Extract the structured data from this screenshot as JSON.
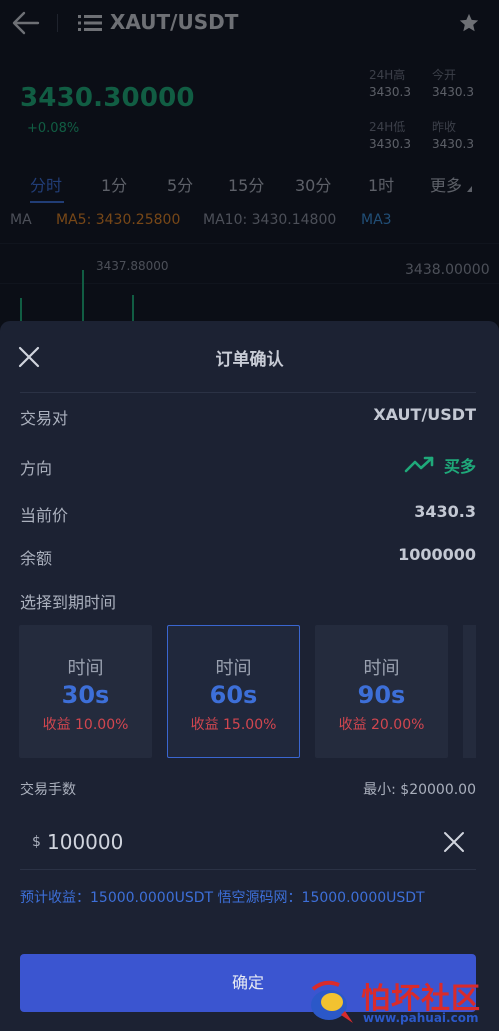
{
  "header": {
    "pair": "XAUT/USDT"
  },
  "ticker": {
    "price": "3430.30000",
    "change": "+0.08%",
    "stats": [
      {
        "label": "24H高",
        "value": "3430.3"
      },
      {
        "label": "今开",
        "value": "3430.3"
      },
      {
        "label": "24H低",
        "value": "3430.3"
      },
      {
        "label": "昨收",
        "value": "3430.3"
      }
    ]
  },
  "periods": [
    "分时",
    "1分",
    "5分",
    "15分",
    "30分",
    "1时",
    "更多"
  ],
  "active_period": "分时",
  "indicators": {
    "ma": "MA",
    "ma5": "MA5: 3430.25800",
    "ma10": "MA10: 3430.14800",
    "ma30": "MA3"
  },
  "chart": {
    "high_label": "3437.88000",
    "axis_label": "3438.00000"
  },
  "sheet": {
    "title": "订单确认",
    "rows": [
      {
        "label": "交易对",
        "value": "XAUT/USDT"
      },
      {
        "label": "方向",
        "value": "买多"
      },
      {
        "label": "当前价",
        "value": "3430.3"
      },
      {
        "label": "余额",
        "value": "1000000"
      }
    ],
    "expiry_title": "选择到期时间",
    "options": [
      {
        "label": "时间",
        "duration": "30s",
        "profit": "收益 10.00%",
        "selected": false
      },
      {
        "label": "时间",
        "duration": "60s",
        "profit": "收益 15.00%",
        "selected": true
      },
      {
        "label": "时间",
        "duration": "90s",
        "profit": "收益 20.00%",
        "selected": false
      }
    ],
    "qty_label": "交易手数",
    "qty_min": "最小: $20000.00",
    "currency": "$",
    "qty_value": "100000",
    "expected": "预计收益：15000.0000USDT   悟空源码网：15000.0000USDT",
    "confirm": "确定"
  },
  "watermark": {
    "title": "怕坏社区",
    "url": "www.pahuai.com"
  },
  "colors": {
    "up_green": "#1fa97a",
    "accent_blue": "#3d6fd8",
    "loss_red": "#d1464f",
    "button_blue": "#3b55d0"
  }
}
